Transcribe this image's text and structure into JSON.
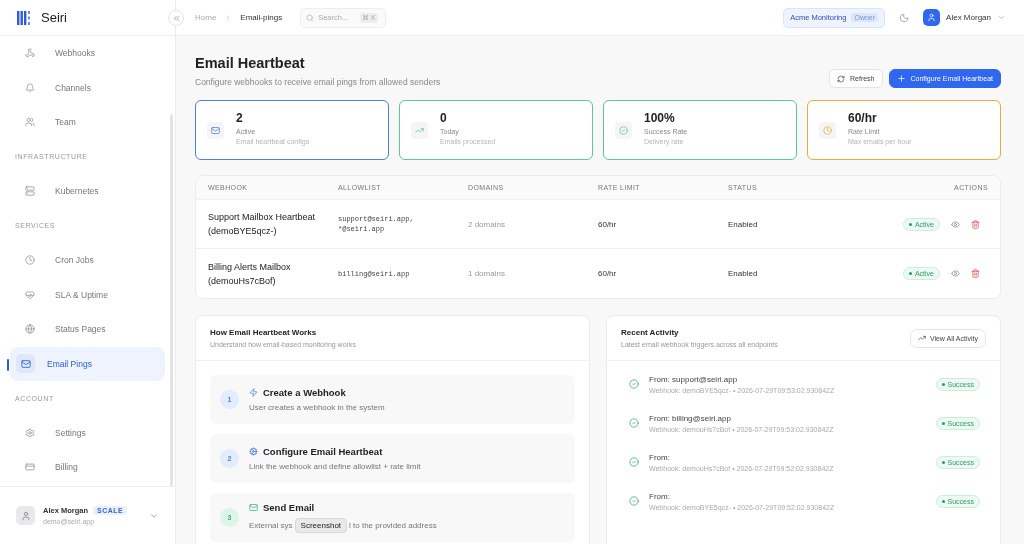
{
  "brand": {
    "name": "Seiri"
  },
  "sidebar": {
    "items": [
      {
        "kind": "item",
        "label": "Webhooks",
        "selected": false
      },
      {
        "kind": "item",
        "label": "Channels",
        "selected": false
      },
      {
        "kind": "item",
        "label": "Team",
        "selected": false
      },
      {
        "kind": "section",
        "label": "INFRASTRUCTURE"
      },
      {
        "kind": "item",
        "label": "Kubernetes",
        "selected": false
      },
      {
        "kind": "section",
        "label": "SERVICES"
      },
      {
        "kind": "item",
        "label": "Cron Jobs",
        "selected": false
      },
      {
        "kind": "item",
        "label": "SLA & Uptime",
        "selected": false
      },
      {
        "kind": "item",
        "label": "Status Pages",
        "selected": false
      },
      {
        "kind": "item",
        "label": "Email Pings",
        "selected": true
      },
      {
        "kind": "section",
        "label": "ACCOUNT"
      },
      {
        "kind": "item",
        "label": "Settings",
        "selected": false
      },
      {
        "kind": "item",
        "label": "Billing",
        "selected": false
      }
    ],
    "user": {
      "name": "Alex Morgan",
      "plan": "SCALE",
      "email": "demo@seiri.app"
    }
  },
  "header": {
    "breadcrumbs": [
      "Home",
      "Email-pings"
    ],
    "search": {
      "placeholder": "Search...",
      "shortcut": "⌘ K"
    },
    "org": {
      "name": "Acme Monitoring",
      "role": "Owner"
    },
    "user": "Alex Morgan"
  },
  "page": {
    "title": "Email Heartbeat",
    "subtitle": "Configure webhooks to receive email pings from allowed senders",
    "buttons": [
      {
        "kind": "refresh",
        "label": "Refresh"
      },
      {
        "kind": "primary",
        "label": "Configure Email Heartbeat"
      }
    ]
  },
  "stats": [
    {
      "value": "2",
      "label": "Active",
      "note": "Email heartbeat configs",
      "color": "#4f7fe0"
    },
    {
      "value": "0",
      "label": "Today",
      "note": "Emails processed",
      "color": "#5cc79a"
    },
    {
      "value": "100%",
      "label": "Success Rate",
      "note": "Delivery rate",
      "color": "#5cc79a"
    },
    {
      "value": "60/hr",
      "label": "Rate Limit",
      "note": "Max emails per hour",
      "color": "#f0a93a"
    }
  ],
  "table": {
    "columns": [
      "WEBHOOK",
      "ALLOWLIST",
      "DOMAINS",
      "RATE LIMIT",
      "STATUS",
      "ACTIONS"
    ],
    "rows": [
      {
        "webhook": "Support Mailbox Heartbeat (demoBYE5qcz-)",
        "allowlist": "support@seiri.app, *@seiri.app",
        "domains": "2 domains",
        "rate_limit": "60/hr",
        "status": "Enabled",
        "badge": "Active"
      },
      {
        "webhook": "Billing Alerts Mailbox (demouHs7cBof)",
        "allowlist": "billing@seiri.app",
        "domains": "1 domains",
        "rate_limit": "60/hr",
        "status": "Enabled",
        "badge": "Active"
      }
    ]
  },
  "how_it_works": {
    "title": "How Email Heartbeat Works",
    "subtitle": "Understand how email-based monitoring works",
    "steps": [
      {
        "number": "1",
        "title": "Create a Webhook",
        "description": "User creates a webhook in the system"
      },
      {
        "number": "2",
        "title": "Configure Email Heartbeat",
        "description": "Link the webhook and define allowlist + rate limit"
      },
      {
        "number": "3",
        "title": "Send Email",
        "description": "External sys",
        "description_after": "l to the provided address"
      }
    ]
  },
  "tooltip": "Screenshot",
  "recent_activity": {
    "title": "Recent Activity",
    "subtitle": "Latest email webhook triggers across all endpoints",
    "button": "View All Activity",
    "items": [
      {
        "from": "From: support@seiri.app",
        "meta": "Webhook: demoBYE5qcz- • 2026-07-29T09:53:02.930842Z",
        "status": "Success"
      },
      {
        "from": "From: billing@seiri.app",
        "meta": "Webhook: demouHs7cBof • 2026-07-29T09:53:02.930842Z",
        "status": "Success"
      },
      {
        "from": "From:",
        "meta": "Webhook: demouHs7cBof • 2026-07-29T09:52:02.930842Z",
        "status": "Success"
      },
      {
        "from": "From:",
        "meta": "Webhook: demoBYE5qcz- • 2026-07-29T09:52:02.930842Z",
        "status": "Success"
      }
    ]
  }
}
